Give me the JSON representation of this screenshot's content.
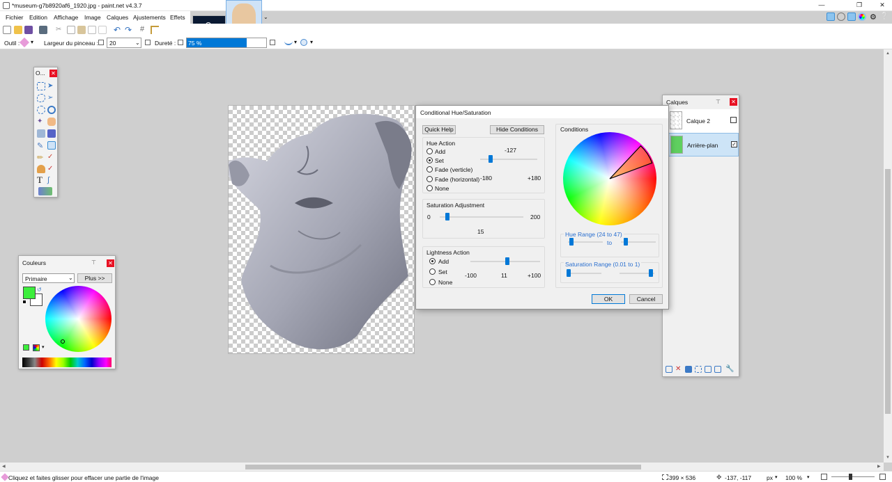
{
  "window": {
    "title": "*museum-g7b8920af6_1920.jpg - paint.net v4.3.7"
  },
  "menu": [
    "Fichier",
    "Edition",
    "Affichage",
    "Image",
    "Calques",
    "Ajustements",
    "Effets"
  ],
  "options": {
    "tool_label": "Outil :",
    "brush_width_label": "Largeur du pinceau :",
    "brush_width_value": "20",
    "hardness_label": "Dureté :",
    "hardness_value": "75 %",
    "hardness_fraction": 0.75
  },
  "tools_panel": {
    "title": "O..."
  },
  "colors_panel": {
    "title": "Couleurs",
    "mode_select": "Primaire",
    "more_button": "Plus >>",
    "primary_color": "#3cee3c",
    "secondary_color": "#ffffff"
  },
  "layers_panel": {
    "title": "Calques",
    "layers": [
      {
        "name": "Calque 2",
        "visible": false
      },
      {
        "name": "Arrière-plan",
        "visible": true
      }
    ]
  },
  "dialog": {
    "title": "Conditional Hue/Saturation",
    "quick_help": "Quick Help",
    "hide_conditions": "Hide Conditions",
    "hue_action": {
      "label": "Hue Action",
      "options": [
        "Add",
        "Set",
        "Fade (verticle)",
        "Fade (horizontal)",
        "None"
      ],
      "selected": "Set",
      "value": "-127",
      "min": "-180",
      "max": "+180"
    },
    "saturation": {
      "label": "Saturation Adjustment",
      "min": "0",
      "max": "200",
      "value": "15"
    },
    "lightness": {
      "label": "Lightness Action",
      "options": [
        "Add",
        "Set",
        "None"
      ],
      "selected": "Add",
      "min": "-100",
      "value": "11",
      "max": "+100"
    },
    "conditions": {
      "label": "Conditions",
      "hue_range_label": "Hue Range (24 to 47)",
      "hue_to": "to",
      "saturation_range_label": "Saturation Range (0.01 to 1)"
    },
    "ok": "OK",
    "cancel": "Cancel"
  },
  "status": {
    "hint": "Cliquez et faites glisser pour effacer une partie de l'image",
    "size": "399 × 536",
    "cursor": "-137, -117",
    "unit": "px",
    "zoom": "100 %"
  },
  "colors": {
    "accent": "#0078d7",
    "close": "#e81123"
  }
}
